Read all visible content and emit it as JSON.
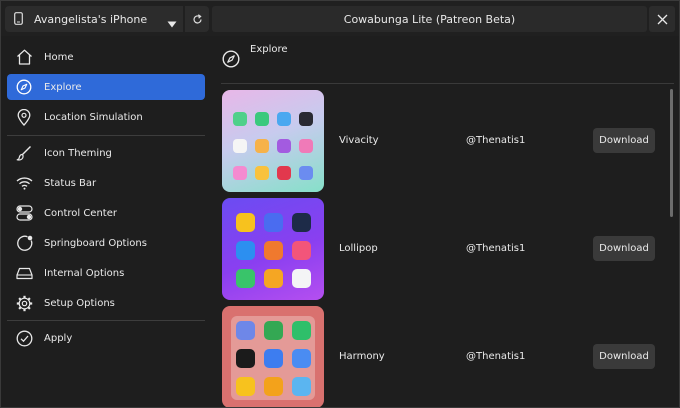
{
  "topbar": {
    "device_name": "Avangelista's iPhone",
    "window_title": "Cowabunga Lite (Patreon Beta)"
  },
  "sidebar": {
    "items": [
      {
        "label": "Home",
        "icon": "home-icon"
      },
      {
        "label": "Explore",
        "icon": "compass-icon",
        "active": true
      },
      {
        "label": "Location Simulation",
        "icon": "location-pin-icon"
      },
      {
        "label": "Icon Theming",
        "icon": "brush-icon"
      },
      {
        "label": "Status Bar",
        "icon": "wifi-icon"
      },
      {
        "label": "Control Center",
        "icon": "toggles-icon"
      },
      {
        "label": "Springboard Options",
        "icon": "springboard-icon"
      },
      {
        "label": "Internal Options",
        "icon": "drive-icon"
      },
      {
        "label": "Setup Options",
        "icon": "gear-icon"
      },
      {
        "label": "Apply",
        "icon": "checkmark-circle-icon"
      }
    ]
  },
  "main": {
    "header": "Explore",
    "themes": [
      {
        "name": "Vivacity",
        "author": "@Thenatis1",
        "button": "Download"
      },
      {
        "name": "Lollipop",
        "author": "@Thenatis1",
        "button": "Download"
      },
      {
        "name": "Harmony",
        "author": "@Thenatis1",
        "button": "Download"
      }
    ]
  },
  "colors": {
    "accent": "#2f6ad9",
    "background": "#1e1e1e",
    "button": "#3a3a3a"
  }
}
